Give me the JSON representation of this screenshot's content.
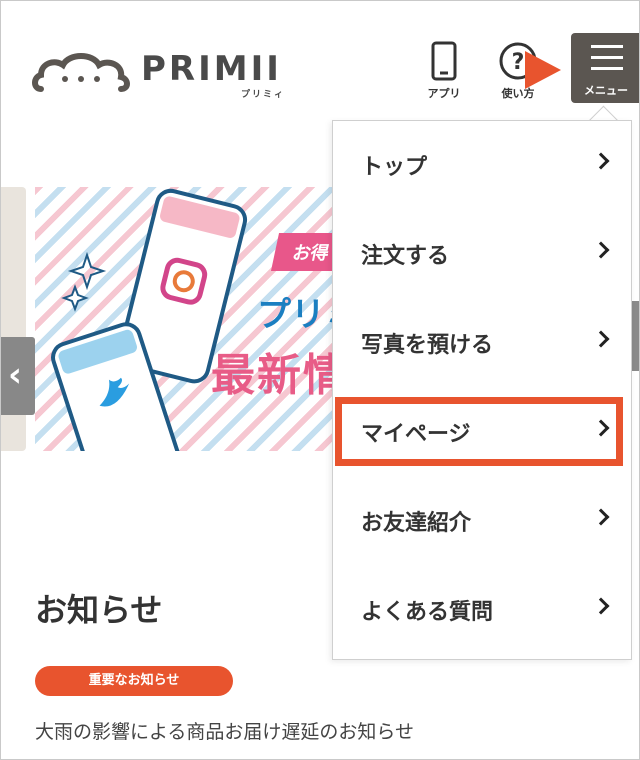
{
  "header": {
    "logo_text": "PRIMII",
    "logo_sub": "プリミィ",
    "app_label": "アプリ",
    "howto_label": "使い方",
    "menu_label": "メニュー"
  },
  "banner": {
    "tag": "お得",
    "line1": "プリミ",
    "line2": "最新情"
  },
  "menu": {
    "items": [
      {
        "label": "トップ"
      },
      {
        "label": "注文する"
      },
      {
        "label": "写真を預ける"
      },
      {
        "label": "マイページ"
      },
      {
        "label": "お友達紹介"
      },
      {
        "label": "よくある質問"
      }
    ]
  },
  "news": {
    "title": "お知らせ",
    "badge": "重要なお知らせ",
    "item": "大雨の影響による商品お届け遅延のお知らせ"
  },
  "colors": {
    "accent": "#e8542e",
    "menu_button": "#5b5651",
    "brand_pink": "#e85c87",
    "brand_blue": "#1b7fc1"
  }
}
